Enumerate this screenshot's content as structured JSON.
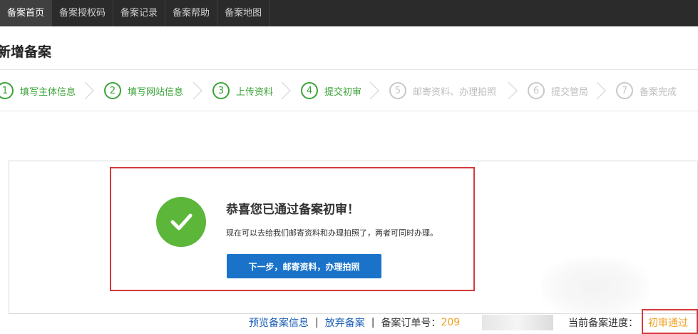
{
  "nav": {
    "items": [
      {
        "label": "备案首页",
        "active": true
      },
      {
        "label": "备案授权码",
        "active": false
      },
      {
        "label": "备案记录",
        "active": false
      },
      {
        "label": "备案帮助",
        "active": false
      },
      {
        "label": "备案地图",
        "active": false
      }
    ]
  },
  "page": {
    "title": "新增备案"
  },
  "steps": [
    {
      "num": "1",
      "label": "填写主体信息",
      "status": "done"
    },
    {
      "num": "2",
      "label": "填写网站信息",
      "status": "done"
    },
    {
      "num": "3",
      "label": "上传资料",
      "status": "done"
    },
    {
      "num": "4",
      "label": "提交初审",
      "status": "current"
    },
    {
      "num": "5",
      "label": "邮寄资料、办理拍照",
      "status": "pending"
    },
    {
      "num": "6",
      "label": "提交管局",
      "status": "pending"
    },
    {
      "num": "7",
      "label": "备案完成",
      "status": "pending"
    }
  ],
  "result": {
    "title": "恭喜您已通过备案初审！",
    "description": "现在可以去给我们邮寄资料和办理拍照了，两者可同时办理。",
    "button_label": "下一步，邮寄资料，办理拍照"
  },
  "footer": {
    "preview_link": "预览备案信息",
    "separator": "|",
    "abandon_link": "放弃备案",
    "order_label": "备案订单号：",
    "order_number_visible": "209",
    "progress_label": "当前备案进度：",
    "status": "初审通过"
  },
  "colors": {
    "step_done": "#3aa336",
    "step_pending": "#c8c8c8",
    "primary_button": "#1a73c8",
    "success_icon": "#5cb63a",
    "highlight_border": "#d6393c",
    "order_number": "#f0a020",
    "link": "#1a5fb4"
  },
  "icons": {
    "success": "check-circle-icon",
    "step_separator": "chevron-right-icon"
  }
}
